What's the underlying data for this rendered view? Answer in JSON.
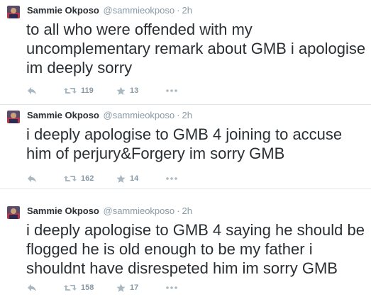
{
  "tweets": [
    {
      "name": "Sammie Okposo",
      "handle": "@sammieokposo",
      "separator": "·",
      "time": "2h",
      "text": "to all who were offended with my uncomplementary remark about GMB i apologise im deeply sorry",
      "retweets": "119",
      "favorites": "13"
    },
    {
      "name": "Sammie Okposo",
      "handle": "@sammieokposo",
      "separator": "·",
      "time": "2h",
      "text": "i deeply apologise to GMB 4 joining to accuse him of perjury&Forgery im sorry GMB",
      "retweets": "162",
      "favorites": "14"
    },
    {
      "name": "Sammie Okposo",
      "handle": "@sammieokposo",
      "separator": "·",
      "time": "2h",
      "text": "i deeply apologise to GMB 4 saying he should be flogged he is old enough to be my father i shouldnt have disrespeted him im sorry GMB",
      "retweets": "158",
      "favorites": "17"
    }
  ],
  "colors": {
    "text": "#292f33",
    "muted": "#8899a6",
    "icon": "#aab8c2",
    "divider": "#e1e8ed"
  },
  "icons": [
    "avatar",
    "reply-icon",
    "retweet-icon",
    "favorite-icon",
    "more-icon"
  ]
}
